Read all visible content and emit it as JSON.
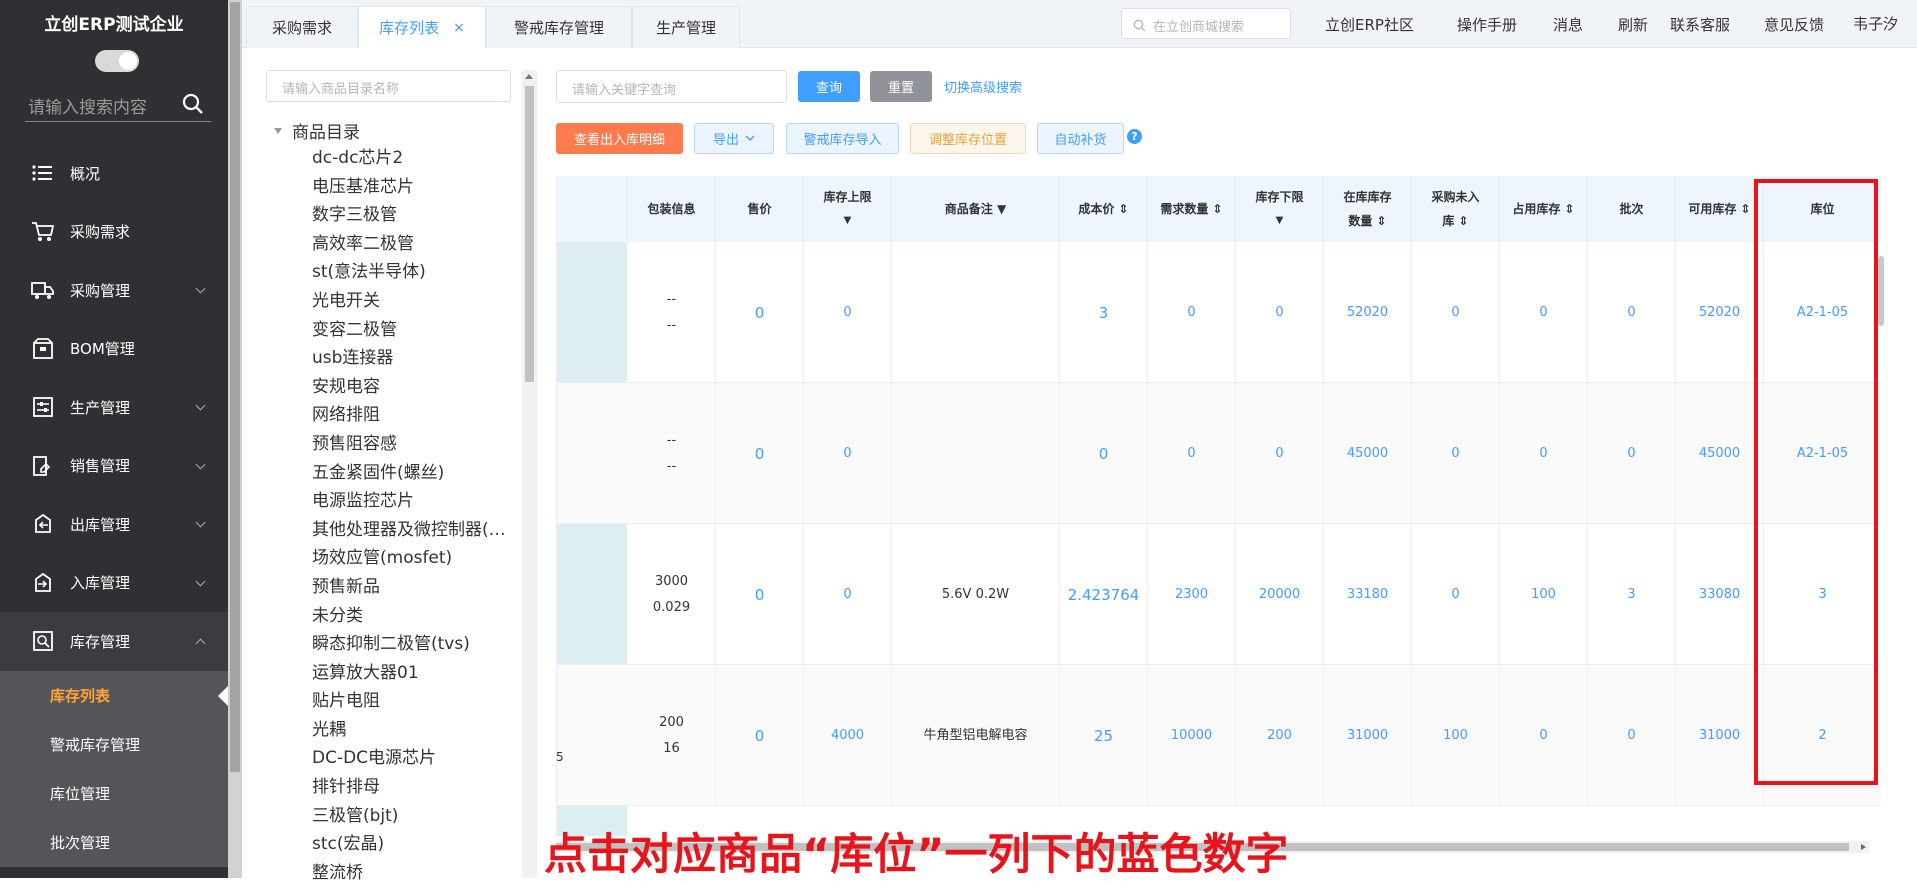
{
  "sidebar": {
    "company": "立创ERP测试企业",
    "search_placeholder": "请输入搜索内容",
    "menu": [
      {
        "label": "概况",
        "icon": "list-icon"
      },
      {
        "label": "采购需求",
        "icon": "cart-icon"
      },
      {
        "label": "采购管理",
        "icon": "truck-icon",
        "caret": true
      },
      {
        "label": "BOM管理",
        "icon": "box-icon"
      },
      {
        "label": "生产管理",
        "icon": "sliders-icon",
        "caret": true
      },
      {
        "label": "销售管理",
        "icon": "sales-icon",
        "caret": true
      },
      {
        "label": "出库管理",
        "icon": "outbound-icon",
        "caret": true
      },
      {
        "label": "入库管理",
        "icon": "inbound-icon",
        "caret": true
      },
      {
        "label": "库存管理",
        "icon": "inventory-icon",
        "caret": true,
        "open": true
      }
    ],
    "submenu": [
      "库存列表",
      "警戒库存管理",
      "库位管理",
      "批次管理"
    ]
  },
  "tabs": [
    {
      "label": "采购需求"
    },
    {
      "label": "库存列表",
      "active": true,
      "close": "×"
    },
    {
      "label": "警戒库存管理"
    },
    {
      "label": "生产管理"
    }
  ],
  "top": {
    "search_placeholder": "在立创商城搜索",
    "links": [
      "立创ERP社区",
      "操作手册",
      "消息",
      "刷新",
      "联系客服",
      "意见反馈",
      "韦子汐"
    ]
  },
  "category": {
    "search_placeholder": "请输入商品目录名称",
    "root": "商品目录",
    "items": [
      "dc-dc芯片2",
      "电压基准芯片",
      "数字三极管",
      "高效率二极管",
      "st(意法半导体)",
      "光电开关",
      "变容二极管",
      "usb连接器",
      "安规电容",
      "网络排阻",
      "预售阻容感",
      "五金紧固件(螺丝)",
      "电源监控芯片",
      "其他处理器及微控制器(MCU)",
      "场效应管(mosfet)",
      "预售新品",
      "未分类",
      "瞬态抑制二极管(tvs)",
      "运算放大器01",
      "贴片电阻",
      "光耦",
      "DC-DC电源芯片",
      "排针排母",
      "三极管(bjt)",
      "stc(宏晶)",
      "整流桥"
    ]
  },
  "query": {
    "keyword_placeholder": "请输入关键字查询",
    "search": "查询",
    "reset": "重置",
    "advanced": "切换高级搜索"
  },
  "toolbar": {
    "detail": "查看出入库明细",
    "export": "导出",
    "import_alert": "警戒库存导入",
    "adjust": "调整库存位置",
    "replenish": "自动补货",
    "help": "?"
  },
  "table": {
    "headers": [
      {
        "l1": "包装信息"
      },
      {
        "l1": "售价"
      },
      {
        "l1": "库存上限",
        "l2": "▼"
      },
      {
        "l1": "商品备注 ▼"
      },
      {
        "l1": "成本价 ⇕"
      },
      {
        "l1": "需求数量 ⇕"
      },
      {
        "l1": "库存下限",
        "l2": "▼"
      },
      {
        "l1": "在库库存",
        "l2": "数量 ⇕"
      },
      {
        "l1": "采购未入",
        "l2": "库 ⇕"
      },
      {
        "l1": "占用库存 ⇕"
      },
      {
        "l1": "批次"
      },
      {
        "l1": "可用库存 ⇕"
      },
      {
        "l1": "库位"
      }
    ],
    "rows": [
      {
        "pack1": "--",
        "pack2": "--",
        "price": "0",
        "upper": "0",
        "remark": "",
        "cost": "3",
        "demand": "0",
        "lower": "0",
        "instock": "52020",
        "onorder": "0",
        "occupied": "0",
        "batch": "0",
        "available": "52020",
        "location": "A2-1-05"
      },
      {
        "pack1": "--",
        "pack2": "--",
        "price": "0",
        "upper": "0",
        "remark": "",
        "cost": "0",
        "demand": "0",
        "lower": "0",
        "instock": "45000",
        "onorder": "0",
        "occupied": "0",
        "batch": "0",
        "available": "45000",
        "location": "A2-1-05"
      },
      {
        "pack1": "3000",
        "pack2": "0.029",
        "price": "0",
        "upper": "0",
        "remark": "5.6V 0.2W",
        "cost": "2.423764",
        "demand": "2300",
        "lower": "20000",
        "instock": "33180",
        "onorder": "0",
        "occupied": "100",
        "batch": "3",
        "available": "33080",
        "location": "3"
      },
      {
        "pack1": "200",
        "pack2": "16",
        "price": "0",
        "upper": "4000",
        "remark": "牛角型铝电解电容",
        "cost": "25",
        "demand": "10000",
        "lower": "200",
        "instock": "31000",
        "onorder": "100",
        "occupied": "0",
        "batch": "0",
        "available": "31000",
        "location": "2"
      }
    ],
    "stray": "5"
  },
  "caption": "点击对应商品“库位”一列下的蓝色数字",
  "colors": {
    "accent": "#409eff",
    "highlight": "#e8141b",
    "active_menu": "#ffa53a"
  }
}
